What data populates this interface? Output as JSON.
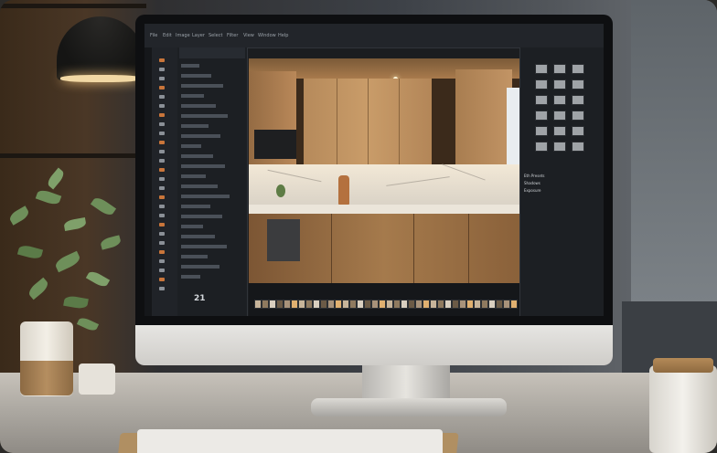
{
  "screen": {
    "app_menu": [
      "File",
      "Edit",
      "Image",
      "Layer",
      "Select",
      "Filter",
      "View",
      "Window",
      "Help"
    ],
    "status_label": "21",
    "right_panel_labels": [
      "Eth Presets",
      "Shadows",
      "Exposure"
    ],
    "filmstrip_count": 36
  },
  "colors": {
    "ui_background": "#1b1d20",
    "panel": "#1c1f23",
    "accent_tool": "#c9753a",
    "cabinet_wood": "#b68a5b",
    "desk": "#c7c2ba"
  }
}
